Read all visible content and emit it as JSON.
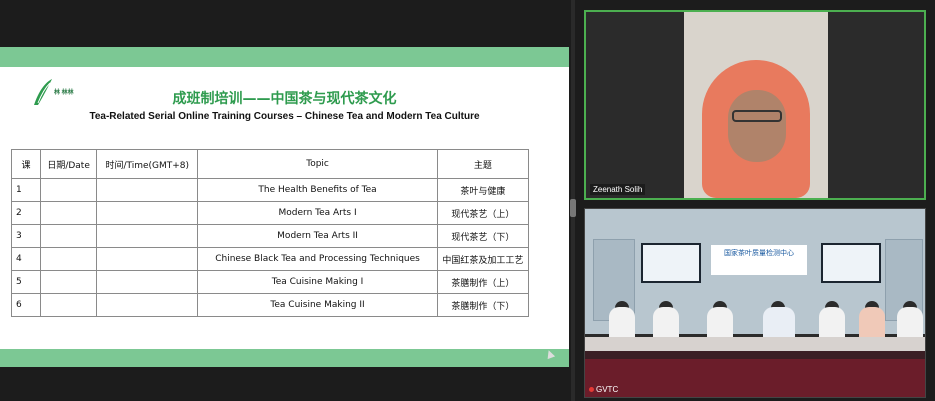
{
  "slide": {
    "logo_text": "林 林林",
    "title_cn": "成班制培训——中国茶与现代茶文化",
    "title_en": "Tea-Related Serial Online Training Courses – Chinese Tea and Modern Tea Culture",
    "headers": {
      "num": "课",
      "date": "日期/Date",
      "time": "时间/Time(GMT+8)",
      "topic": "Topic",
      "topic_cn": "主题"
    },
    "rows": [
      {
        "num": "1",
        "date": "",
        "time": "",
        "topic": "The Health Benefits of Tea",
        "topic_cn": "茶叶与健康"
      },
      {
        "num": "2",
        "date": "",
        "time": "",
        "topic": "Modern Tea Arts I",
        "topic_cn": "现代茶艺（上）"
      },
      {
        "num": "3",
        "date": "",
        "time": "",
        "topic": "Modern Tea Arts II",
        "topic_cn": "现代茶艺（下）"
      },
      {
        "num": "4",
        "date": "",
        "time": "",
        "topic": "Chinese Black Tea and Processing Techniques",
        "topic_cn": "中国红茶及加工工艺"
      },
      {
        "num": "5",
        "date": "",
        "time": "",
        "topic": "Tea Cuisine Making I",
        "topic_cn": "茶膳制作（上）"
      },
      {
        "num": "6",
        "date": "",
        "time": "",
        "topic": "Tea Cuisine Making II",
        "topic_cn": "茶膳制作（下）"
      }
    ]
  },
  "participants": {
    "tile1_name": "Zeenath Solih",
    "tile2_name": "GVTC",
    "room_banner": "国家茶叶质量检测中心"
  },
  "colors": {
    "accent_green": "#7cc894",
    "title_green": "#2e9b4e",
    "active_speaker_border": "#4caf50"
  }
}
